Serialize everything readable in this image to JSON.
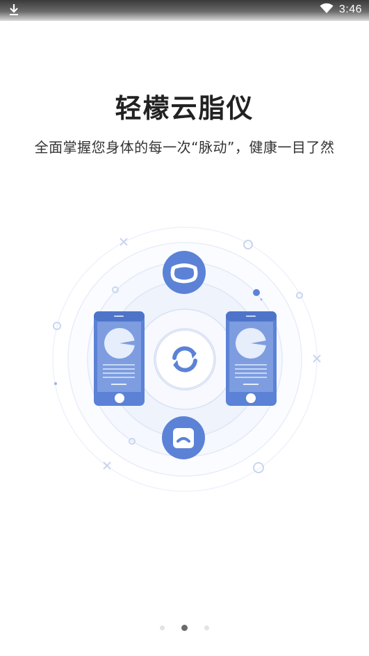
{
  "status_bar": {
    "time": "3:46",
    "left_icon": "download-icon",
    "right_icon": "wifi-icon"
  },
  "content": {
    "title": "轻檬云脂仪",
    "subtitle": "全面掌握您身体的每一次“脉动”，健康一目了然"
  },
  "illustration": {
    "top_icon": "scale-icon",
    "bottom_icon": "scale-side-icon",
    "center_icon": "sync-icon",
    "accent_color": "#5b82d6",
    "ring_color": "#e9eef9"
  },
  "pager": {
    "pages": 3,
    "current": 2
  }
}
